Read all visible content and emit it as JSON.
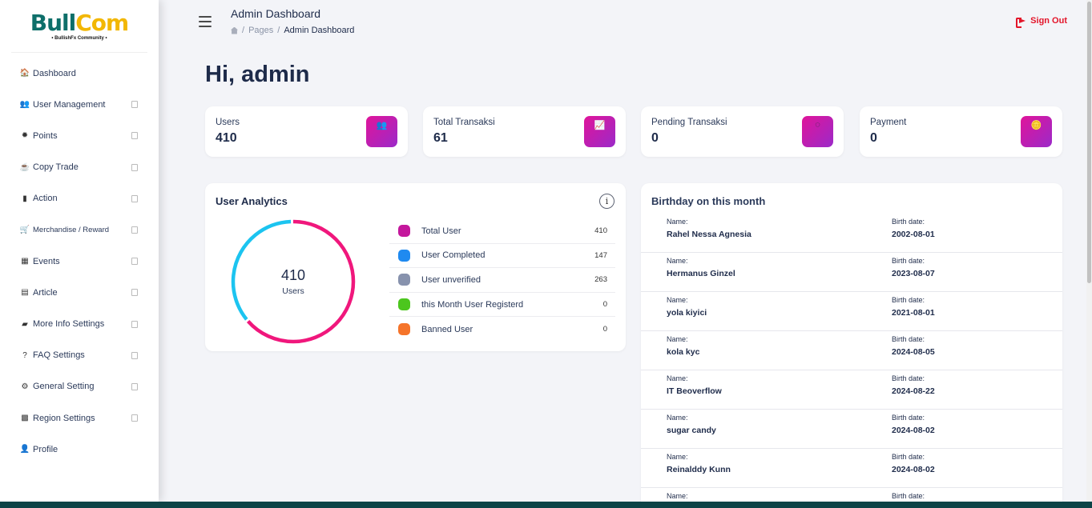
{
  "logo": {
    "part1": "Bull",
    "part2": "Com",
    "tagline": "• BullishFx Community •"
  },
  "sidebar": {
    "items": [
      {
        "label": "Dashboard",
        "icon": "🏠",
        "has_chevron": false
      },
      {
        "label": "User Management",
        "icon": "👥",
        "has_chevron": true
      },
      {
        "label": "Points",
        "icon": "✹",
        "has_chevron": true
      },
      {
        "label": "Copy Trade",
        "icon": "☕",
        "has_chevron": true
      },
      {
        "label": "Action",
        "icon": "▮",
        "has_chevron": true
      },
      {
        "label": "Merchandise / Reward",
        "icon": "🛒",
        "has_chevron": true
      },
      {
        "label": "Events",
        "icon": "▦",
        "has_chevron": true
      },
      {
        "label": "Article",
        "icon": "▤",
        "has_chevron": true
      },
      {
        "label": "More Info Settings",
        "icon": "▰",
        "has_chevron": true
      },
      {
        "label": "FAQ Settings",
        "icon": "?",
        "has_chevron": true
      },
      {
        "label": "General Setting",
        "icon": "⚙",
        "has_chevron": true
      },
      {
        "label": "Region Settings",
        "icon": "▩",
        "has_chevron": true
      },
      {
        "label": "Profile",
        "icon": "👤",
        "has_chevron": false
      }
    ]
  },
  "header": {
    "title": "Admin Dashboard",
    "breadcrumb": {
      "sep": "/",
      "pages": "Pages",
      "current": "Admin Dashboard"
    },
    "signout_label": "Sign Out"
  },
  "greeting": "Hi, admin",
  "stats": [
    {
      "label": "Users",
      "value": "410",
      "icon": "👥"
    },
    {
      "label": "Total Transaksi",
      "value": "61",
      "icon": "📈"
    },
    {
      "label": "Pending Transaksi",
      "value": "0",
      "icon": "◌"
    },
    {
      "label": "Payment",
      "value": "0",
      "icon": "🪙"
    }
  ],
  "analytics": {
    "title": "User Analytics",
    "info_icon": "i",
    "center_value": "410",
    "center_label": "Users",
    "legend": [
      {
        "label": "Total User",
        "value": "410",
        "color": "#c4179c"
      },
      {
        "label": "User Completed",
        "value": "147",
        "color": "#1f8af0"
      },
      {
        "label": "User unverified",
        "value": "263",
        "color": "#8792ad"
      },
      {
        "label": "this Month User Registerd",
        "value": "0",
        "color": "#4cc61e"
      },
      {
        "label": "Banned User",
        "value": "0",
        "color": "#f5742a"
      }
    ],
    "ring": {
      "completed": 147,
      "unverified": 263,
      "colors": {
        "completed": "#1cc4f0",
        "unverified": "#f0177c"
      }
    }
  },
  "birthday": {
    "title": "Birthday on this month",
    "name_key": "Name:",
    "date_key": "Birth date:",
    "rows": [
      {
        "name": "Rahel Nessa Agnesia",
        "date": "2002-08-01"
      },
      {
        "name": "Hermanus Ginzel",
        "date": "2023-08-07"
      },
      {
        "name": "yola kiyici",
        "date": "2021-08-01"
      },
      {
        "name": "kola kyc",
        "date": "2024-08-05"
      },
      {
        "name": "IT Beoverflow",
        "date": "2024-08-22"
      },
      {
        "name": "sugar candy",
        "date": "2024-08-02"
      },
      {
        "name": "Reinalddy Kunn",
        "date": "2024-08-02"
      },
      {
        "name": "",
        "date": ""
      }
    ]
  }
}
